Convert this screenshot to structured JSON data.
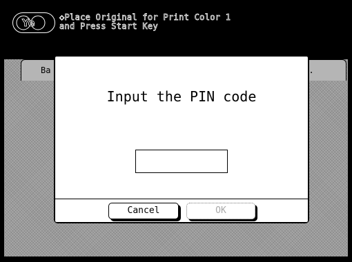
{
  "header": {
    "color_badge_label": "Ye",
    "message_line1": "◇Place Original for Print Color 1",
    "message_line2": "and Press Start Key"
  },
  "tabs": [
    {
      "label": "Ba"
    },
    {
      "label": "in."
    }
  ],
  "dialog": {
    "prompt": "Input the PIN code",
    "pin_value": "",
    "cancel_label": "Cancel",
    "ok_label": "OK",
    "ok_enabled": false
  }
}
